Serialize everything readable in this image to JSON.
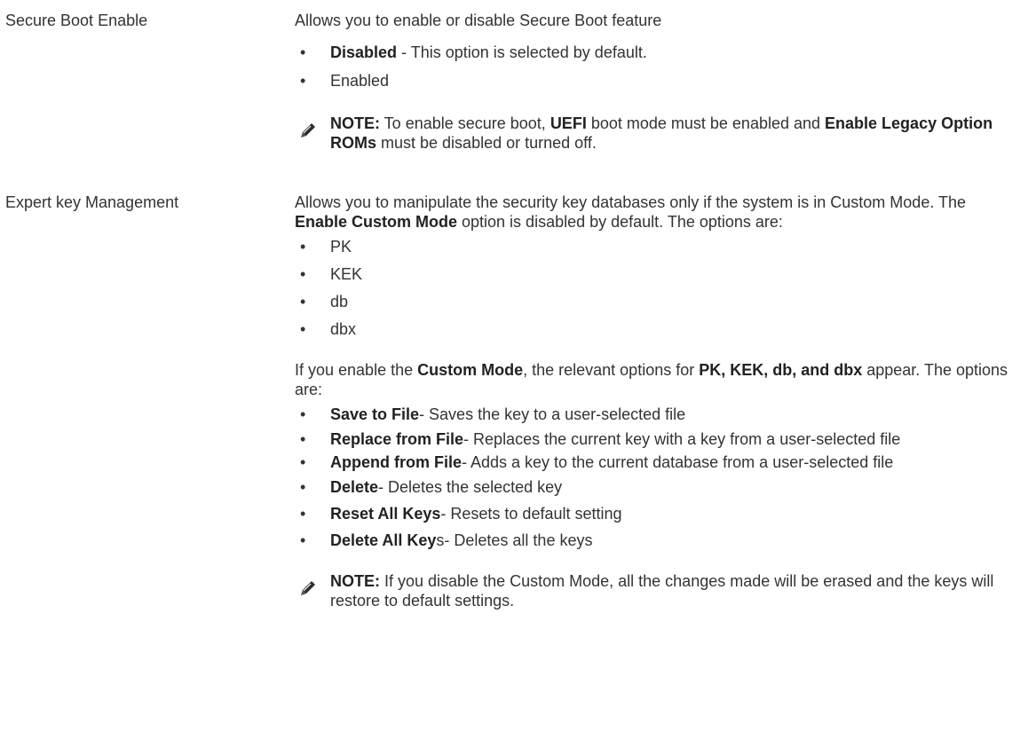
{
  "rows": [
    {
      "label": "Secure Boot Enable",
      "description": "Allows you to enable or disable Secure Boot feature",
      "options": [
        {
          "bold": "Disabled",
          "text": " - This option is selected by default."
        },
        {
          "bold": "",
          "text": "Enabled"
        }
      ],
      "note": {
        "label": "NOTE:",
        "parts": [
          {
            "text": " To enable secure boot, "
          },
          {
            "bold": "UEFI"
          },
          {
            "text": " boot mode must be enabled and "
          },
          {
            "bold": "Enable Legacy Option ROMs"
          },
          {
            "text": " must be disabled or turned off."
          }
        ]
      }
    },
    {
      "label": "Expert key Management",
      "intro_parts": [
        {
          "text": "Allows you to manipulate the security key databases only if the system is in Custom Mode. The "
        },
        {
          "bold": "Enable Custom Mode"
        },
        {
          "text": " option is disabled by default. The options are:"
        }
      ],
      "key_options": [
        "PK",
        "KEK",
        "db",
        "dbx"
      ],
      "custom_parts": [
        {
          "text": "If you enable the "
        },
        {
          "bold": "Custom Mode"
        },
        {
          "text": ", the relevant options for "
        },
        {
          "bold": "PK, KEK, db, and dbx"
        },
        {
          "text": " appear. The options are:"
        }
      ],
      "custom_options": [
        {
          "bold": "Save to File",
          "text": "- Saves the key to a user-selected file"
        },
        {
          "bold": "Replace from File",
          "text": "- Replaces the current key with a key from a user-selected file"
        },
        {
          "bold": "Append from File",
          "text": "- Adds a key to the current database from a user-selected file"
        },
        {
          "bold": "Delete",
          "text": "- Deletes the selected key"
        },
        {
          "bold": "Reset All Keys",
          "text": "- Resets to default setting"
        },
        {
          "bold": "Delete All Key",
          "text": "s- Deletes all the keys"
        }
      ],
      "note": {
        "label": "NOTE:",
        "parts": [
          {
            "text": " If you disable the Custom Mode, all the changes made will be erased and the keys will restore to default settings."
          }
        ]
      }
    }
  ],
  "icons": {
    "note": "pencil-icon"
  },
  "colors": {
    "text": "#333333",
    "bold": "#222222",
    "icon": "#2d2d2d"
  }
}
